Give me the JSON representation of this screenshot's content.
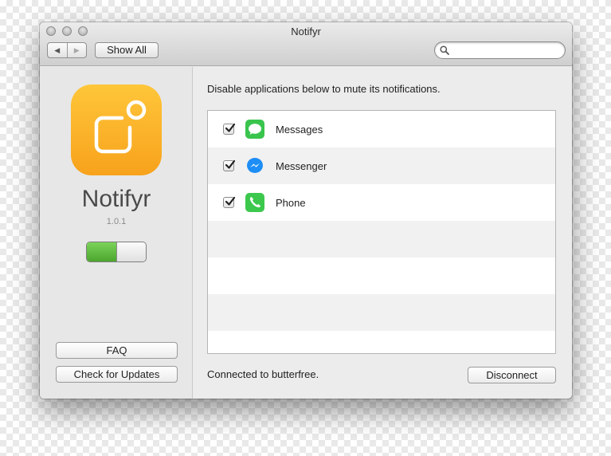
{
  "window": {
    "title": "Notifyr"
  },
  "toolbar": {
    "back_icon": "chevron-left-icon",
    "forward_icon": "chevron-right-icon",
    "show_all_label": "Show All",
    "search": {
      "placeholder": "",
      "value": "",
      "icon": "search-icon"
    }
  },
  "sidebar": {
    "app_icon": "notification-badge-icon",
    "app_name": "Notifyr",
    "version": "1.0.1",
    "toggle": {
      "on": true,
      "on_color": "#5bbb3b"
    },
    "faq_label": "FAQ",
    "updates_label": "Check for Updates"
  },
  "main": {
    "instruction": "Disable applications below to mute its notifications.",
    "apps": [
      {
        "name": "Messages",
        "checked": true,
        "icon": "speech-bubble-icon",
        "color": "#39c44d"
      },
      {
        "name": "Messenger",
        "checked": true,
        "icon": "messenger-icon",
        "color": "#1d8ef5"
      },
      {
        "name": "Phone",
        "checked": true,
        "icon": "phone-icon",
        "color": "#3cc84d"
      }
    ],
    "status": "Connected to butterfree.",
    "disconnect_label": "Disconnect"
  },
  "colors": {
    "accent_orange": "#f9b12a",
    "window_bg": "#ececec"
  }
}
